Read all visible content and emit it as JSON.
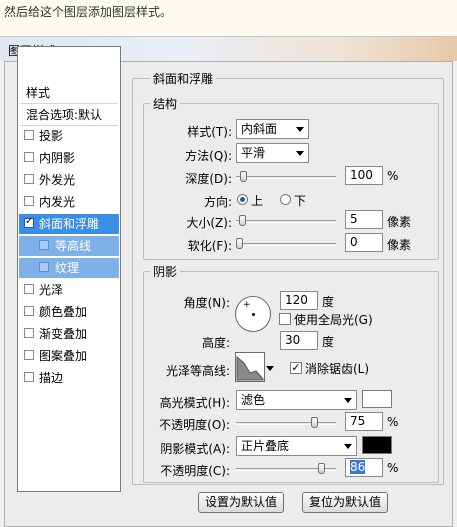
{
  "caption": "然后给这个图层添加图层样式。",
  "dialog": {
    "title": "图层样式"
  },
  "sidebar": {
    "header": "样式",
    "blend_options": "混合选项:默认",
    "items": [
      {
        "label": "投影",
        "checked": false
      },
      {
        "label": "内阴影",
        "checked": false
      },
      {
        "label": "外发光",
        "checked": false
      },
      {
        "label": "内发光",
        "checked": false
      },
      {
        "label": "斜面和浮雕",
        "checked": true
      },
      {
        "label": "等高线",
        "checked": false
      },
      {
        "label": "纹理",
        "checked": false
      },
      {
        "label": "光泽",
        "checked": false
      },
      {
        "label": "颜色叠加",
        "checked": false
      },
      {
        "label": "渐变叠加",
        "checked": false
      },
      {
        "label": "图案叠加",
        "checked": false
      },
      {
        "label": "描边",
        "checked": false
      }
    ]
  },
  "panel": {
    "title": "斜面和浮雕",
    "structure": {
      "title": "结构",
      "style_label": "样式(T):",
      "style_value": "内斜面",
      "technique_label": "方法(Q):",
      "technique_value": "平滑",
      "depth_label": "深度(D):",
      "depth_value": "100",
      "depth_unit": "%",
      "direction_label": "方向:",
      "direction_up": "上",
      "direction_down": "下",
      "direction_selected": "上",
      "size_label": "大小(Z):",
      "size_value": "5",
      "size_unit": "像素",
      "soften_label": "软化(F):",
      "soften_value": "0",
      "soften_unit": "像素"
    },
    "shading": {
      "title": "阴影",
      "angle_label": "角度(N):",
      "angle_value": "120",
      "angle_unit": "度",
      "global_light_label": "使用全局光(G)",
      "global_light_checked": false,
      "altitude_label": "高度:",
      "altitude_value": "30",
      "altitude_unit": "度",
      "gloss_contour_label": "光泽等高线:",
      "anti_alias_label": "消除锯齿(L)",
      "anti_alias_checked": true,
      "highlight_mode_label": "高光模式(H):",
      "highlight_mode_value": "滤色",
      "highlight_color": "#ffffff",
      "highlight_opacity_label": "不透明度(O):",
      "highlight_opacity_value": "75",
      "highlight_opacity_unit": "%",
      "shadow_mode_label": "阴影模式(A):",
      "shadow_mode_value": "正片叠底",
      "shadow_color": "#000000",
      "shadow_opacity_label": "不透明度(C):",
      "shadow_opacity_value": "86",
      "shadow_opacity_unit": "%"
    },
    "buttons": {
      "make_default": "设置为默认值",
      "reset_default": "复位为默认值"
    }
  }
}
